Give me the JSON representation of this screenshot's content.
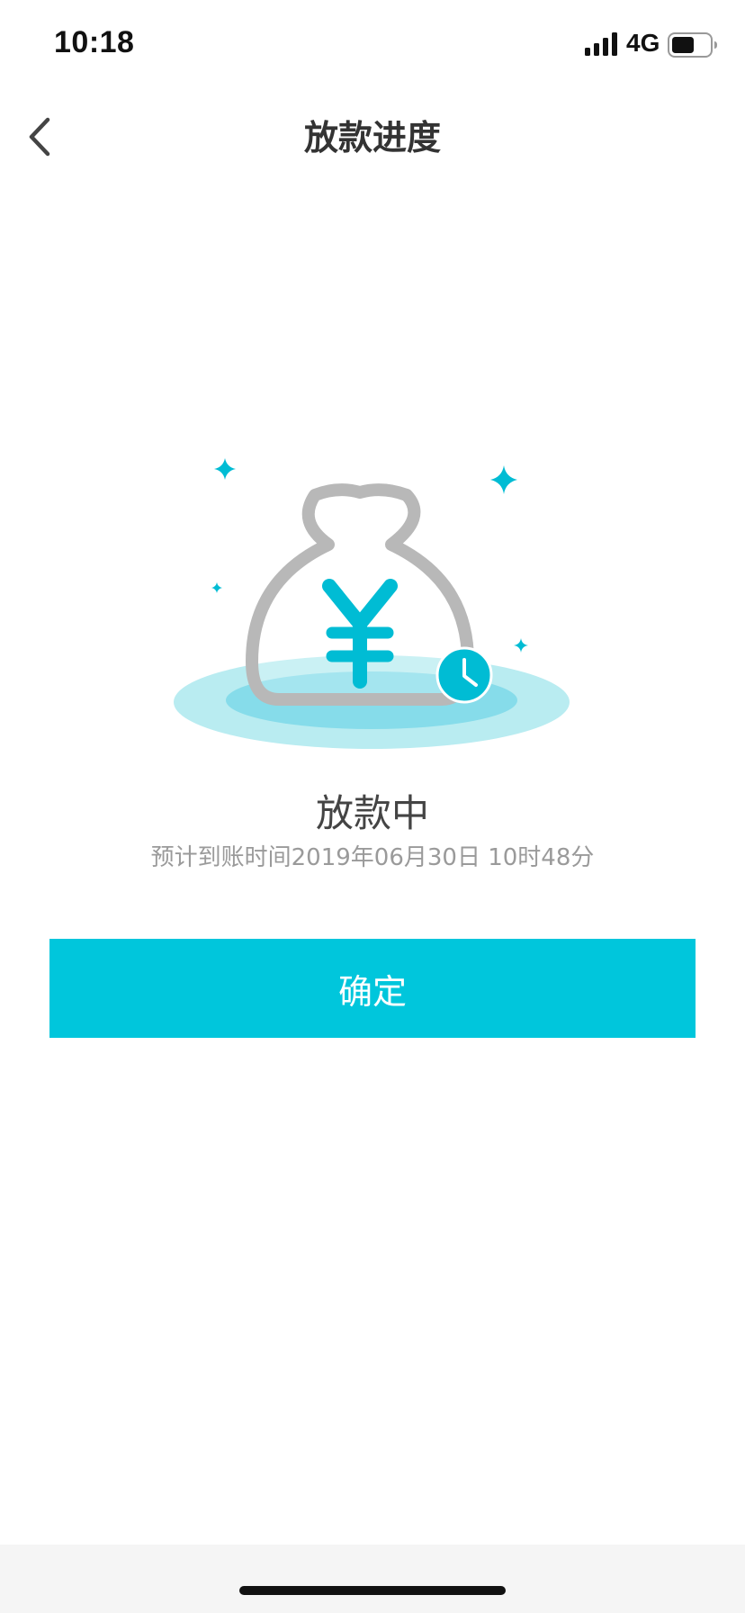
{
  "status_bar": {
    "time": "10:18",
    "network": "4G",
    "signal_icon": "signal-bars-icon",
    "battery_icon": "battery-icon"
  },
  "nav": {
    "title": "放款进度",
    "back_icon": "chevron-left-icon"
  },
  "illustration": {
    "icon": "money-bag-icon",
    "symbol": "¥",
    "badge_icon": "clock-icon"
  },
  "status": {
    "title": "放款中",
    "subtitle": "预计到账时间2019年06月30日 10时48分"
  },
  "actions": {
    "confirm_label": "确定"
  },
  "colors": {
    "accent": "#00c6dc",
    "bag_outline": "#b8b8b8",
    "glow_outer": "#b9ecf1",
    "glow_inner": "#86dcea"
  }
}
